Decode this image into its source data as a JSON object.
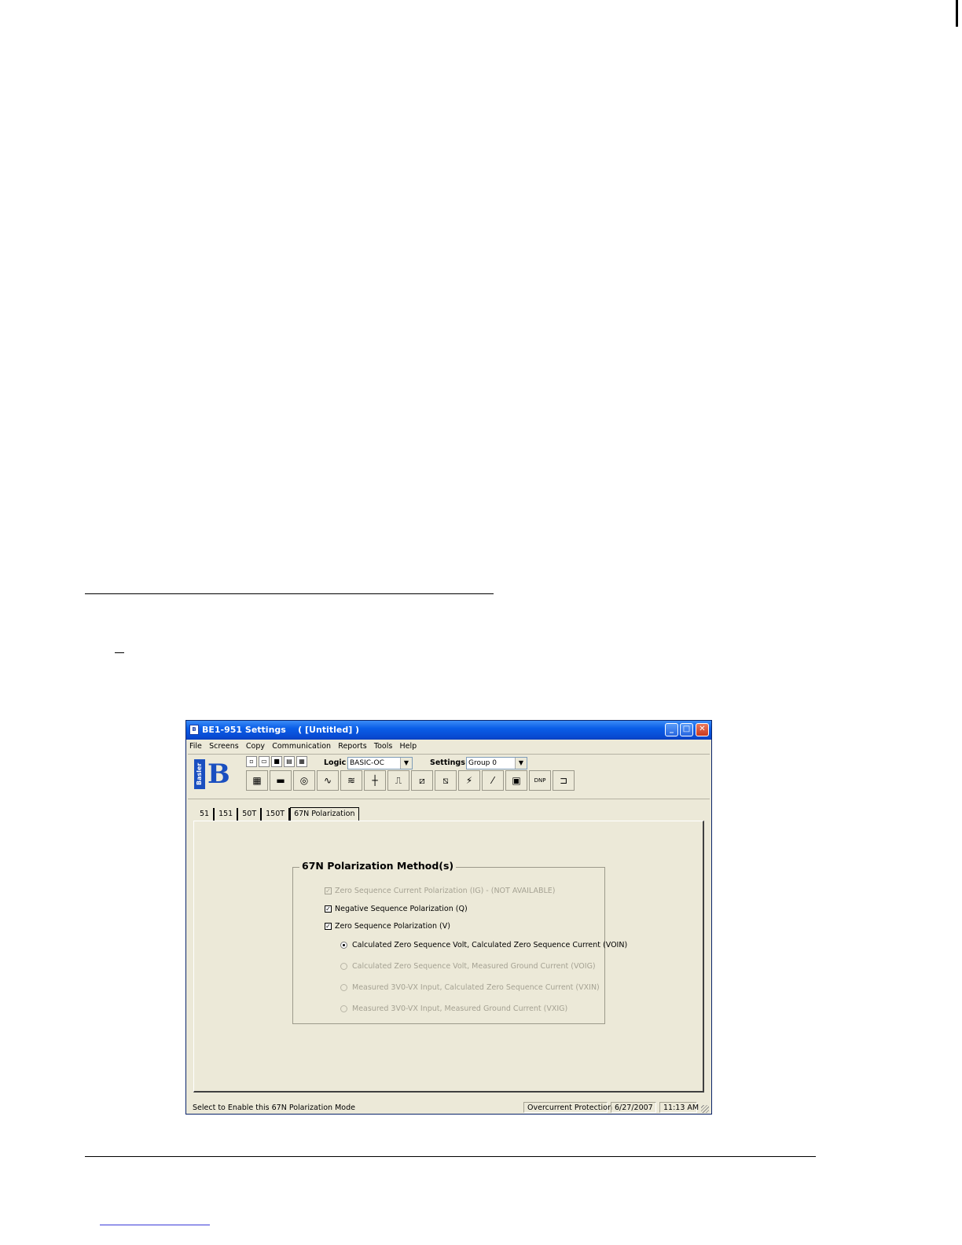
{
  "window": {
    "title": "BE1-951 Settings    ( [Untitled] )",
    "icon_label": "B"
  },
  "menu": [
    "File",
    "Screens",
    "Copy",
    "Communication",
    "Reports",
    "Tools",
    "Help"
  ],
  "toolbar": {
    "logo_text": "Basler",
    "logo_letter": "B",
    "logic_label": "Logic",
    "logic_value": "BASIC-OC",
    "settings_label": "Settings",
    "settings_value": "Group 0",
    "dnp_label": "DNP"
  },
  "tabs": [
    "51",
    "151",
    "50T",
    "150T",
    "67N Polarization"
  ],
  "group": {
    "title": "67N Polarization Method(s)",
    "options": [
      {
        "label": "Zero Sequence Current Polarization (IG) - (NOT AVAILABLE)",
        "checked": true,
        "enabled": false
      },
      {
        "label": "Negative Sequence Polarization (Q)",
        "checked": true,
        "enabled": true
      },
      {
        "label": "Zero Sequence Polarization (V)",
        "checked": true,
        "enabled": true
      }
    ],
    "radios": [
      {
        "label": "Calculated Zero Sequence Volt, Calculated Zero Sequence Current (VOIN)",
        "selected": true,
        "enabled": true
      },
      {
        "label": "Calculated Zero Sequence Volt, Measured Ground Current (VOIG)",
        "selected": false,
        "enabled": false
      },
      {
        "label": "Measured 3V0-VX Input, Calculated Zero Sequence Current (VXIN)",
        "selected": false,
        "enabled": false
      },
      {
        "label": "Measured 3V0-VX Input, Measured Ground Current (VXIG)",
        "selected": false,
        "enabled": false
      }
    ]
  },
  "status": {
    "message": "Select to Enable this 67N Polarization Mode",
    "section": "Overcurrent Protection",
    "date": "6/27/2007",
    "time": "11:13 AM"
  }
}
